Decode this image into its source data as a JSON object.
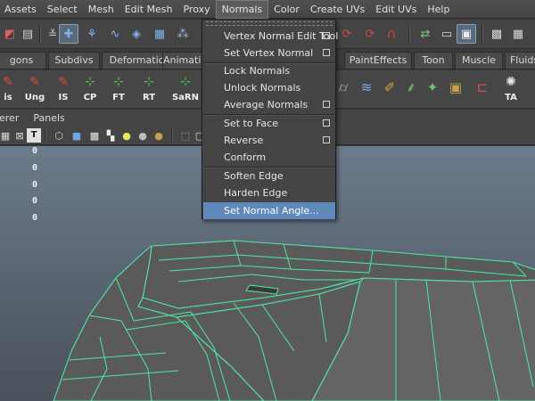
{
  "menubar": {
    "items": [
      "Assets",
      "Select",
      "Mesh",
      "Edit Mesh",
      "Proxy",
      "Normals",
      "Color",
      "Create UVs",
      "Edit UVs",
      "Help"
    ],
    "active": "Normals"
  },
  "shelf_tabs": [
    "gons",
    "Subdivs",
    "Deformation",
    "Animatio",
    "PaintEffects",
    "Toon",
    "Muscle",
    "Fluids"
  ],
  "shelf_items": [
    "is",
    "Ung",
    "IS",
    "CP",
    "FT",
    "RT",
    "SaRN",
    "TA"
  ],
  "panel_menu": [
    "erer",
    "Panels"
  ],
  "viewport": {
    "hud_values": [
      "0",
      "0",
      "0",
      "0",
      "0"
    ],
    "wire_color": "#4fe7a4",
    "mesh_color": "#5a5a5a"
  },
  "dropdown": {
    "items": [
      {
        "label": "Vertex Normal Edit Tool",
        "option_box": true
      },
      {
        "label": "Set Vertex Normal",
        "option_box": true
      },
      {
        "label": "Lock Normals",
        "option_box": false
      },
      {
        "label": "Unlock Normals",
        "option_box": false
      },
      {
        "label": "Average Normals",
        "option_box": true
      },
      {
        "label": "Set to Face",
        "option_box": true
      },
      {
        "label": "Reverse",
        "option_box": true
      },
      {
        "label": "Conform",
        "option_box": false
      },
      {
        "label": "Soften Edge",
        "option_box": false
      },
      {
        "label": "Harden Edge",
        "option_box": false
      },
      {
        "label": "Set Normal Angle...",
        "option_box": false
      }
    ],
    "highlighted": "Set Normal Angle...",
    "highlight_color": "#5f88bb"
  }
}
